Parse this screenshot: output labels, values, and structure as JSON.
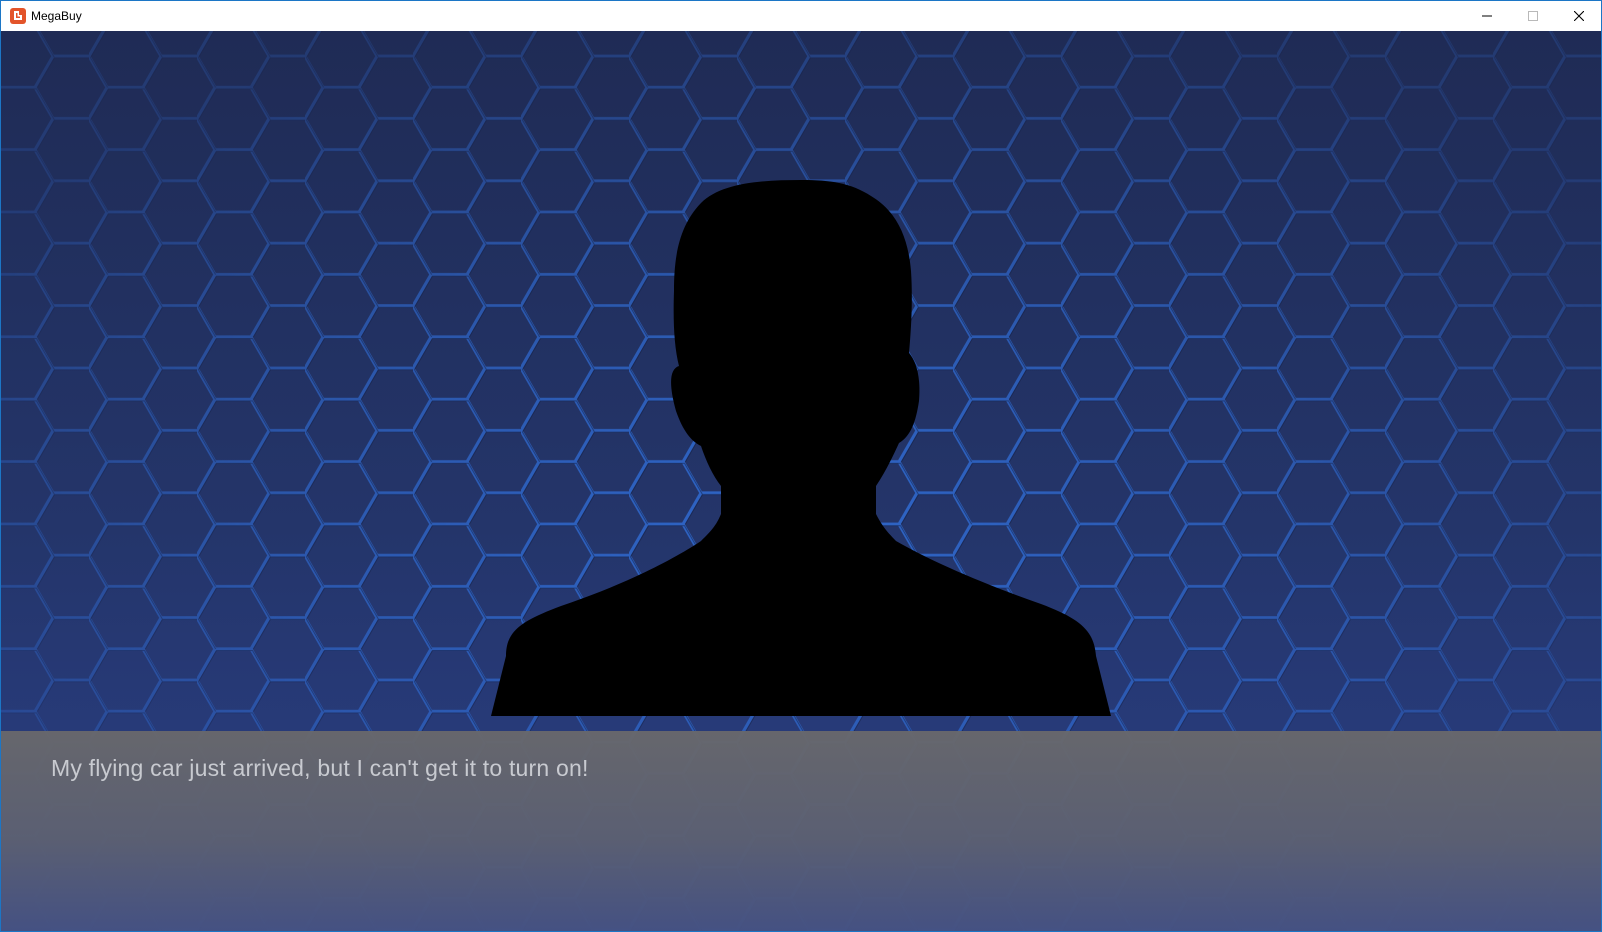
{
  "window": {
    "title": "MegaBuy",
    "app_icon": "megabuy-logo-icon",
    "controls": {
      "minimize_icon": "minimize-icon",
      "maximize_icon": "maximize-icon",
      "close_icon": "close-icon"
    },
    "border_color": "#1c76c6"
  },
  "scene": {
    "background": "blue-hexagon-pattern",
    "character": "customer-silhouette",
    "colors": {
      "hex_line": "#2f66c8",
      "background_dark": "#1f2b55",
      "background_light": "#2a3f86",
      "silhouette": "#000000"
    }
  },
  "dialogue": {
    "text": "My flying car just arrived, but I can't get it to turn on!",
    "text_color": "#c8cad0"
  }
}
